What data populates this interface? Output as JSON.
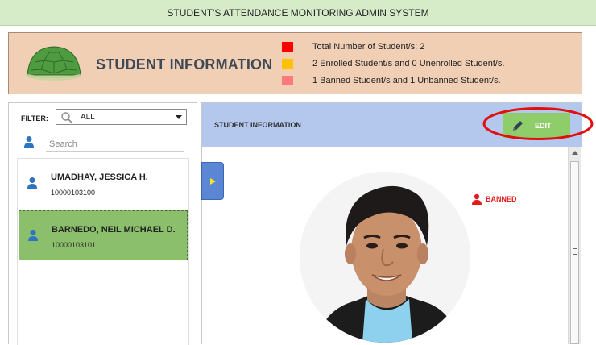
{
  "app": {
    "title": "STUDENT'S ATTENDANCE MONITORING ADMIN SYSTEM"
  },
  "header": {
    "title": "STUDENT INFORMATION",
    "stats": [
      {
        "text": "Total Number of Student/s: 2",
        "color": "#ff0000"
      },
      {
        "text": "2 Enrolled Student/s and 0 Unenrolled Student/s.",
        "color": "#ffc000"
      },
      {
        "text": "1 Banned Student/s and 1 Unbanned Student/s.",
        "color": "#ff7b7b"
      }
    ]
  },
  "filter": {
    "label": "FILTER:",
    "value": "ALL"
  },
  "search": {
    "placeholder": "Search"
  },
  "students": [
    {
      "name": "UMADHAY, JESSICA H.",
      "id": "10000103100",
      "selected": false
    },
    {
      "name": "BARNEDO, NEIL MICHAEL D.",
      "id": "10000103101",
      "selected": true
    }
  ],
  "detail": {
    "title": "STUDENT INFORMATION",
    "edit_label": "EDIT",
    "status": "BANNED"
  },
  "colors": {
    "accent_green": "#8cbf6c",
    "header_blue": "#b4c8ee",
    "banned_red": "#e31b1b"
  }
}
